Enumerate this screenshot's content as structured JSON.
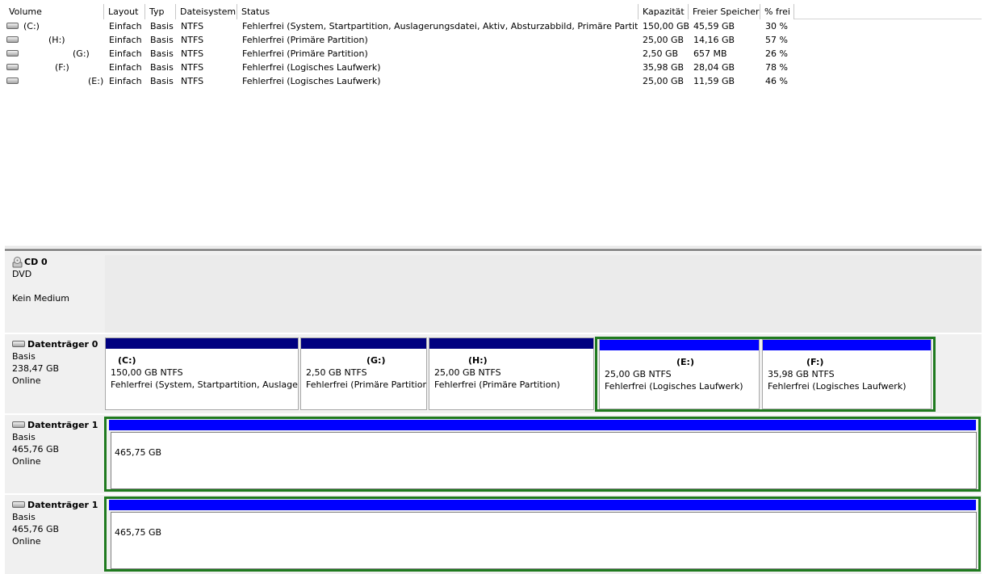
{
  "columns": [
    "Volume",
    "Layout",
    "Typ",
    "Dateisystem",
    "Status",
    "Kapazität",
    "Freier Speicher",
    "% frei"
  ],
  "volumes": [
    {
      "volume": "(C:)",
      "layout": "Einfach",
      "typ": "Basis",
      "fs": "NTFS",
      "status": "Fehlerfrei (System, Startpartition, Auslagerungsdatei, Aktiv, Absturzabbild, Primäre Partition)",
      "capacity": "150,00 GB",
      "free": "45,59 GB",
      "pct": "30 %"
    },
    {
      "volume": "(H:)",
      "layout": "Einfach",
      "typ": "Basis",
      "fs": "NTFS",
      "status": "Fehlerfrei (Primäre Partition)",
      "capacity": "25,00 GB",
      "free": "14,16 GB",
      "pct": "57 %"
    },
    {
      "volume": "(G:)",
      "layout": "Einfach",
      "typ": "Basis",
      "fs": "NTFS",
      "status": "Fehlerfrei (Primäre Partition)",
      "capacity": "2,50 GB",
      "free": "657 MB",
      "pct": "26 %"
    },
    {
      "volume": "(F:)",
      "layout": "Einfach",
      "typ": "Basis",
      "fs": "NTFS",
      "status": "Fehlerfrei (Logisches Laufwerk)",
      "capacity": "35,98 GB",
      "free": "28,04 GB",
      "pct": "78 %"
    },
    {
      "volume": "(E:)",
      "layout": "Einfach",
      "typ": "Basis",
      "fs": "NTFS",
      "status": "Fehlerfrei (Logisches Laufwerk)",
      "capacity": "25,00 GB",
      "free": "11,59 GB",
      "pct": "46 %"
    }
  ],
  "cd0": {
    "name": "CD 0",
    "type": "DVD",
    "media": "Kein Medium"
  },
  "disk0": {
    "name": "Datenträger 0",
    "type": "Basis",
    "size": "238,47 GB",
    "state": "Online",
    "partitions": [
      {
        "title": "(C:)",
        "size": "150,00 GB NTFS",
        "status": "Fehlerfrei (System, Startpartition, Auslagerungsdatei, Aktiv, Absturzabbild, Primäre Partition)"
      },
      {
        "title": "(G:)",
        "size": "2,50 GB NTFS",
        "status": "Fehlerfrei (Primäre Partition)"
      },
      {
        "title": "(H:)",
        "size": "25,00 GB NTFS",
        "status": "Fehlerfrei (Primäre Partition)"
      },
      {
        "title": "(E:)",
        "size": "25,00 GB NTFS",
        "status": "Fehlerfrei (Logisches Laufwerk)"
      },
      {
        "title": "(F:)",
        "size": "35,98 GB NTFS",
        "status": "Fehlerfrei (Logisches Laufwerk)"
      }
    ]
  },
  "disk1a": {
    "name": "Datenträger 1",
    "type": "Basis",
    "size": "465,76 GB",
    "state": "Online",
    "partition_size": "465,75 GB"
  },
  "disk1b": {
    "name": "Datenträger 1",
    "type": "Basis",
    "size": "465,76 GB",
    "state": "Online",
    "partition_size": "465,75 GB"
  },
  "colors": {
    "primary_bar": "#000080",
    "logical_bar": "#0000ff",
    "extended_frame": "#1f7a1f"
  }
}
